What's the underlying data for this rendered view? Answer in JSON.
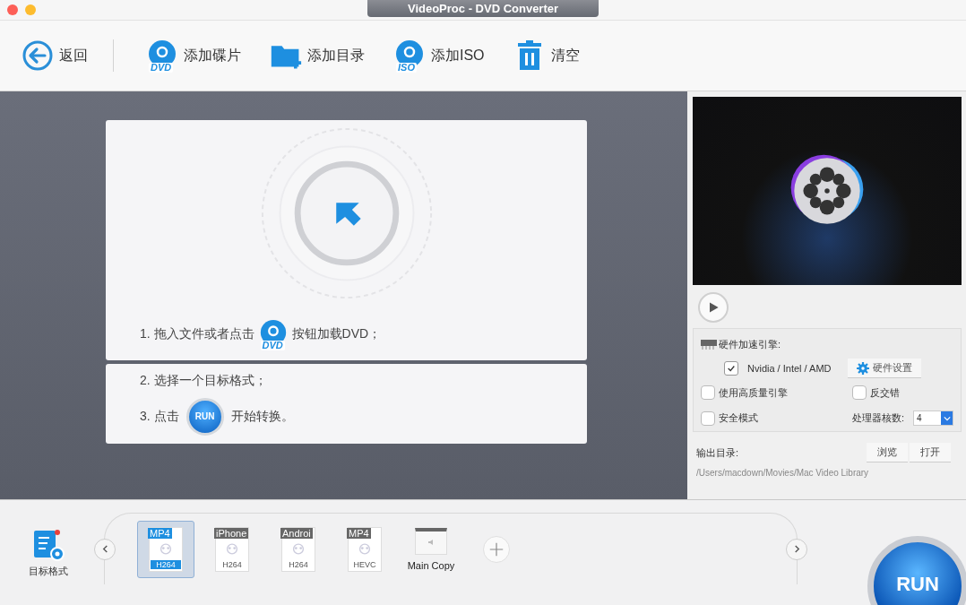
{
  "window": {
    "title": "VideoProc - DVD Converter"
  },
  "toolbar": [
    {
      "kind": "back",
      "label": "返回"
    },
    {
      "kind": "disc",
      "label": "添加碟片",
      "badge": "DVD"
    },
    {
      "kind": "folder",
      "label": "添加目录"
    },
    {
      "kind": "disc",
      "label": "添加ISO",
      "badge": "ISO"
    },
    {
      "kind": "trash",
      "label": "清空"
    }
  ],
  "instructions": {
    "step1_before": "1. 拖入文件或者点击",
    "step1_badge": "DVD",
    "step1_after": "按钮加载DVD；",
    "step2": "2. 选择一个目标格式；",
    "step3_before": "3. 点击",
    "step3_badge": "RUN",
    "step3_after": "开始转换。"
  },
  "hardware": {
    "title": "硬件加速引擎:",
    "gpu": {
      "label": "Nvidia /  Intel / AMD",
      "checked": true
    },
    "settings_button": "硬件设置",
    "options": [
      {
        "label": "使用高质量引擎",
        "checked": false
      },
      {
        "label": "反交错",
        "checked": false
      },
      {
        "label": "安全模式",
        "checked": false
      }
    ],
    "cores_label": "处理器核数:",
    "cores_value": "4"
  },
  "output": {
    "label": "输出目录:",
    "buttons": [
      "浏览",
      "打开"
    ],
    "path": "/Users/macdown/Movies/Mac Video Library"
  },
  "target_format": {
    "label": "目标格式"
  },
  "formats": [
    {
      "kind": "profile",
      "tag": "MP4",
      "codec": "H264",
      "selected": true
    },
    {
      "kind": "profile",
      "tag": "iPhone",
      "codec": "H264",
      "selected": false
    },
    {
      "kind": "profile",
      "tag": "Androi",
      "codec": "H264",
      "selected": false
    },
    {
      "kind": "profile",
      "tag": "MP4",
      "codec": "HEVC",
      "selected": false
    },
    {
      "kind": "copy",
      "label": "Main Copy",
      "selected": false
    }
  ],
  "run_button": "RUN"
}
